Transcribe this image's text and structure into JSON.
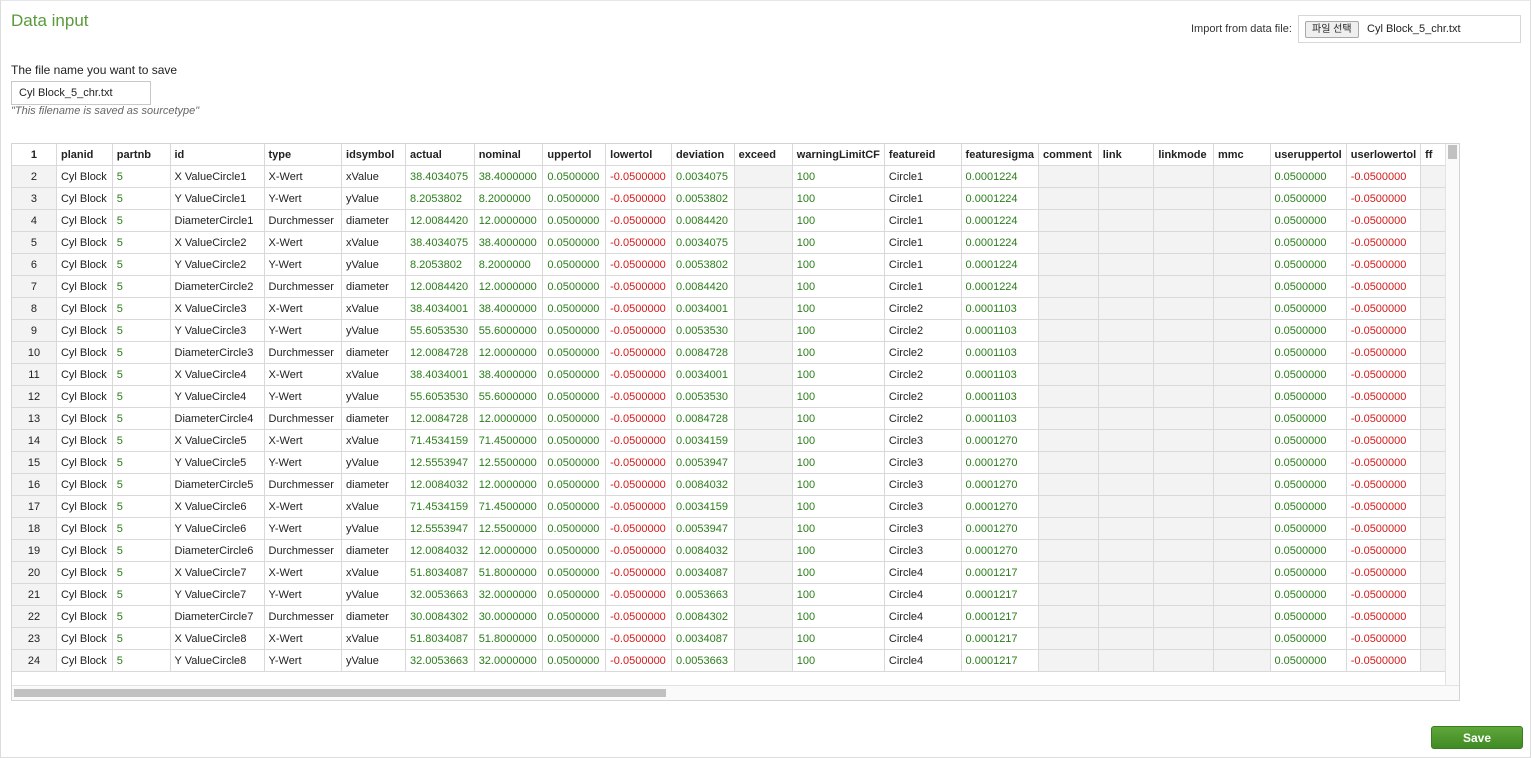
{
  "page": {
    "title": "Data input",
    "import_label": "Import from data file:",
    "import_button": "파일 선택",
    "import_filename": "Cyl Block_5_chr.txt",
    "filename_label": "The file name you want to save",
    "filename_value": "Cyl Block_5_chr.txt",
    "filename_hint": "\"This filename is saved as sourcetype\"",
    "save_label": "Save"
  },
  "colors": {
    "positive": "#2a7d1a",
    "negative": "#d11a1a",
    "accent": "#5a9a3c"
  },
  "grid": {
    "header_row_number": "1",
    "columns": [
      "planid",
      "partnb",
      "id",
      "type",
      "idsymbol",
      "actual",
      "nominal",
      "uppertol",
      "lowertol",
      "deviation",
      "exceed",
      "warningLimitCF",
      "featureid",
      "featuresigma",
      "comment",
      "link",
      "linkmode",
      "mmc",
      "useruppertol",
      "userlowertol",
      "ff"
    ],
    "rows": [
      [
        "2",
        "Cyl Block",
        "5",
        "X ValueCircle1",
        "X-Wert",
        "xValue",
        "38.4034075",
        "38.4000000",
        "0.0500000",
        "-0.0500000",
        "0.0034075",
        "",
        "100",
        "Circle1",
        "0.0001224",
        "",
        "",
        "",
        "",
        "0.0500000",
        "-0.0500000",
        ""
      ],
      [
        "3",
        "Cyl Block",
        "5",
        "Y ValueCircle1",
        "Y-Wert",
        "yValue",
        "8.2053802",
        "8.2000000",
        "0.0500000",
        "-0.0500000",
        "0.0053802",
        "",
        "100",
        "Circle1",
        "0.0001224",
        "",
        "",
        "",
        "",
        "0.0500000",
        "-0.0500000",
        ""
      ],
      [
        "4",
        "Cyl Block",
        "5",
        "DiameterCircle1",
        "Durchmesser",
        "diameter",
        "12.0084420",
        "12.0000000",
        "0.0500000",
        "-0.0500000",
        "0.0084420",
        "",
        "100",
        "Circle1",
        "0.0001224",
        "",
        "",
        "",
        "",
        "0.0500000",
        "-0.0500000",
        ""
      ],
      [
        "5",
        "Cyl Block",
        "5",
        "X ValueCircle2",
        "X-Wert",
        "xValue",
        "38.4034075",
        "38.4000000",
        "0.0500000",
        "-0.0500000",
        "0.0034075",
        "",
        "100",
        "Circle1",
        "0.0001224",
        "",
        "",
        "",
        "",
        "0.0500000",
        "-0.0500000",
        ""
      ],
      [
        "6",
        "Cyl Block",
        "5",
        "Y ValueCircle2",
        "Y-Wert",
        "yValue",
        "8.2053802",
        "8.2000000",
        "0.0500000",
        "-0.0500000",
        "0.0053802",
        "",
        "100",
        "Circle1",
        "0.0001224",
        "",
        "",
        "",
        "",
        "0.0500000",
        "-0.0500000",
        ""
      ],
      [
        "7",
        "Cyl Block",
        "5",
        "DiameterCircle2",
        "Durchmesser",
        "diameter",
        "12.0084420",
        "12.0000000",
        "0.0500000",
        "-0.0500000",
        "0.0084420",
        "",
        "100",
        "Circle1",
        "0.0001224",
        "",
        "",
        "",
        "",
        "0.0500000",
        "-0.0500000",
        ""
      ],
      [
        "8",
        "Cyl Block",
        "5",
        "X ValueCircle3",
        "X-Wert",
        "xValue",
        "38.4034001",
        "38.4000000",
        "0.0500000",
        "-0.0500000",
        "0.0034001",
        "",
        "100",
        "Circle2",
        "0.0001103",
        "",
        "",
        "",
        "",
        "0.0500000",
        "-0.0500000",
        ""
      ],
      [
        "9",
        "Cyl Block",
        "5",
        "Y ValueCircle3",
        "Y-Wert",
        "yValue",
        "55.6053530",
        "55.6000000",
        "0.0500000",
        "-0.0500000",
        "0.0053530",
        "",
        "100",
        "Circle2",
        "0.0001103",
        "",
        "",
        "",
        "",
        "0.0500000",
        "-0.0500000",
        ""
      ],
      [
        "10",
        "Cyl Block",
        "5",
        "DiameterCircle3",
        "Durchmesser",
        "diameter",
        "12.0084728",
        "12.0000000",
        "0.0500000",
        "-0.0500000",
        "0.0084728",
        "",
        "100",
        "Circle2",
        "0.0001103",
        "",
        "",
        "",
        "",
        "0.0500000",
        "-0.0500000",
        ""
      ],
      [
        "11",
        "Cyl Block",
        "5",
        "X ValueCircle4",
        "X-Wert",
        "xValue",
        "38.4034001",
        "38.4000000",
        "0.0500000",
        "-0.0500000",
        "0.0034001",
        "",
        "100",
        "Circle2",
        "0.0001103",
        "",
        "",
        "",
        "",
        "0.0500000",
        "-0.0500000",
        ""
      ],
      [
        "12",
        "Cyl Block",
        "5",
        "Y ValueCircle4",
        "Y-Wert",
        "yValue",
        "55.6053530",
        "55.6000000",
        "0.0500000",
        "-0.0500000",
        "0.0053530",
        "",
        "100",
        "Circle2",
        "0.0001103",
        "",
        "",
        "",
        "",
        "0.0500000",
        "-0.0500000",
        ""
      ],
      [
        "13",
        "Cyl Block",
        "5",
        "DiameterCircle4",
        "Durchmesser",
        "diameter",
        "12.0084728",
        "12.0000000",
        "0.0500000",
        "-0.0500000",
        "0.0084728",
        "",
        "100",
        "Circle2",
        "0.0001103",
        "",
        "",
        "",
        "",
        "0.0500000",
        "-0.0500000",
        ""
      ],
      [
        "14",
        "Cyl Block",
        "5",
        "X ValueCircle5",
        "X-Wert",
        "xValue",
        "71.4534159",
        "71.4500000",
        "0.0500000",
        "-0.0500000",
        "0.0034159",
        "",
        "100",
        "Circle3",
        "0.0001270",
        "",
        "",
        "",
        "",
        "0.0500000",
        "-0.0500000",
        ""
      ],
      [
        "15",
        "Cyl Block",
        "5",
        "Y ValueCircle5",
        "Y-Wert",
        "yValue",
        "12.5553947",
        "12.5500000",
        "0.0500000",
        "-0.0500000",
        "0.0053947",
        "",
        "100",
        "Circle3",
        "0.0001270",
        "",
        "",
        "",
        "",
        "0.0500000",
        "-0.0500000",
        ""
      ],
      [
        "16",
        "Cyl Block",
        "5",
        "DiameterCircle5",
        "Durchmesser",
        "diameter",
        "12.0084032",
        "12.0000000",
        "0.0500000",
        "-0.0500000",
        "0.0084032",
        "",
        "100",
        "Circle3",
        "0.0001270",
        "",
        "",
        "",
        "",
        "0.0500000",
        "-0.0500000",
        ""
      ],
      [
        "17",
        "Cyl Block",
        "5",
        "X ValueCircle6",
        "X-Wert",
        "xValue",
        "71.4534159",
        "71.4500000",
        "0.0500000",
        "-0.0500000",
        "0.0034159",
        "",
        "100",
        "Circle3",
        "0.0001270",
        "",
        "",
        "",
        "",
        "0.0500000",
        "-0.0500000",
        ""
      ],
      [
        "18",
        "Cyl Block",
        "5",
        "Y ValueCircle6",
        "Y-Wert",
        "yValue",
        "12.5553947",
        "12.5500000",
        "0.0500000",
        "-0.0500000",
        "0.0053947",
        "",
        "100",
        "Circle3",
        "0.0001270",
        "",
        "",
        "",
        "",
        "0.0500000",
        "-0.0500000",
        ""
      ],
      [
        "19",
        "Cyl Block",
        "5",
        "DiameterCircle6",
        "Durchmesser",
        "diameter",
        "12.0084032",
        "12.0000000",
        "0.0500000",
        "-0.0500000",
        "0.0084032",
        "",
        "100",
        "Circle3",
        "0.0001270",
        "",
        "",
        "",
        "",
        "0.0500000",
        "-0.0500000",
        ""
      ],
      [
        "20",
        "Cyl Block",
        "5",
        "X ValueCircle7",
        "X-Wert",
        "xValue",
        "51.8034087",
        "51.8000000",
        "0.0500000",
        "-0.0500000",
        "0.0034087",
        "",
        "100",
        "Circle4",
        "0.0001217",
        "",
        "",
        "",
        "",
        "0.0500000",
        "-0.0500000",
        ""
      ],
      [
        "21",
        "Cyl Block",
        "5",
        "Y ValueCircle7",
        "Y-Wert",
        "yValue",
        "32.0053663",
        "32.0000000",
        "0.0500000",
        "-0.0500000",
        "0.0053663",
        "",
        "100",
        "Circle4",
        "0.0001217",
        "",
        "",
        "",
        "",
        "0.0500000",
        "-0.0500000",
        ""
      ],
      [
        "22",
        "Cyl Block",
        "5",
        "DiameterCircle7",
        "Durchmesser",
        "diameter",
        "30.0084302",
        "30.0000000",
        "0.0500000",
        "-0.0500000",
        "0.0084302",
        "",
        "100",
        "Circle4",
        "0.0001217",
        "",
        "",
        "",
        "",
        "0.0500000",
        "-0.0500000",
        ""
      ],
      [
        "23",
        "Cyl Block",
        "5",
        "X ValueCircle8",
        "X-Wert",
        "xValue",
        "51.8034087",
        "51.8000000",
        "0.0500000",
        "-0.0500000",
        "0.0034087",
        "",
        "100",
        "Circle4",
        "0.0001217",
        "",
        "",
        "",
        "",
        "0.0500000",
        "-0.0500000",
        ""
      ],
      [
        "24",
        "Cyl Block",
        "5",
        "Y ValueCircle8",
        "Y-Wert",
        "yValue",
        "32.0053663",
        "32.0000000",
        "0.0500000",
        "-0.0500000",
        "0.0053663",
        "",
        "100",
        "Circle4",
        "0.0001217",
        "",
        "",
        "",
        "",
        "0.0500000",
        "-0.0500000",
        ""
      ]
    ]
  }
}
